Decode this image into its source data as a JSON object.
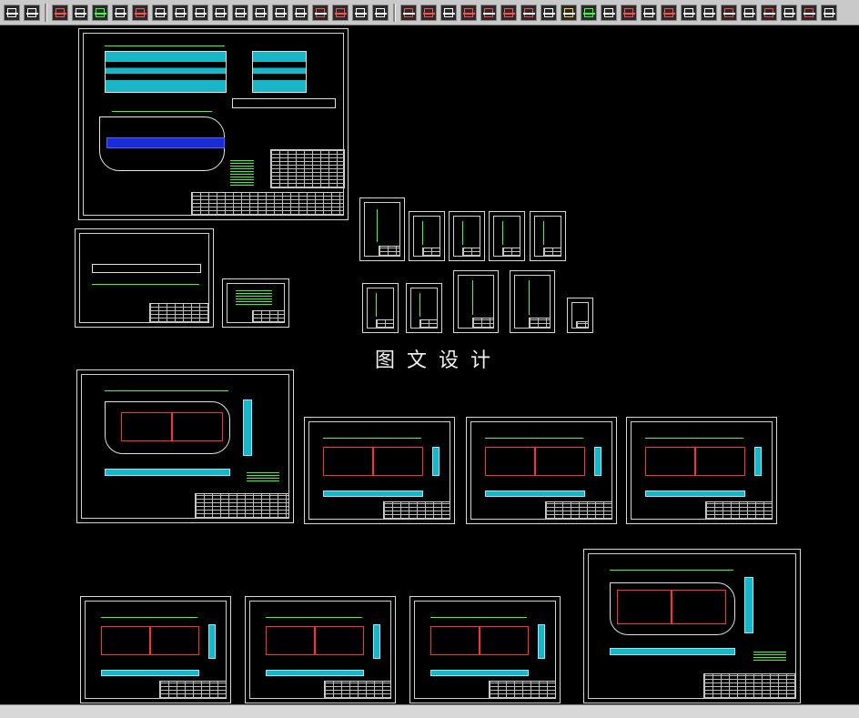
{
  "toolbar": {
    "buttons": [
      {
        "icon": "table-tool-icon",
        "color": "#ffffff"
      },
      {
        "icon": "text-style-icon",
        "color": "#ffffff"
      },
      {
        "icon": "hatch-pattern-icon",
        "color": "#ff4f4f"
      },
      {
        "icon": "dimension-style-icon",
        "color": "#ffffff"
      },
      {
        "icon": "layer-icon",
        "color": "#3cff3c"
      },
      {
        "icon": "linear-dimension-icon",
        "color": "#ffffff"
      },
      {
        "icon": "circle-mark-icon",
        "color": "#ff4f4f"
      },
      {
        "icon": "list-icon",
        "color": "#ffffff"
      },
      {
        "icon": "fork-icon",
        "color": "#ffffff"
      },
      {
        "icon": "frame-icon",
        "color": "#ffffff"
      },
      {
        "icon": "column-icon",
        "color": "#ffffff"
      },
      {
        "icon": "diagonal-tool-icon",
        "color": "#ffffff"
      },
      {
        "icon": "section-icon",
        "color": "#ffffff"
      },
      {
        "icon": "grid-icon",
        "color": "#ffffff"
      },
      {
        "icon": "split-icon",
        "color": "#ffffff"
      },
      {
        "icon": "gear-symbol-icon",
        "color": "#ff4f4f"
      },
      {
        "icon": "target-icon",
        "color": "#ff4f4f"
      },
      {
        "icon": "fork-down-icon",
        "color": "#ffffff"
      },
      {
        "icon": "bracket-icon",
        "color": "#ffffff"
      },
      {
        "icon": "cross-axis-icon",
        "color": "#ff4f4f"
      },
      {
        "icon": "rectangle-flag-icon",
        "color": "#ff4f4f"
      },
      {
        "icon": "diagonal-arrow-icon",
        "color": "#ffffff"
      },
      {
        "icon": "chevron-diagonal-icon",
        "color": "#ff4f4f"
      },
      {
        "icon": "wave-line-icon",
        "color": "#ff4f4f"
      },
      {
        "icon": "bar-graph-icon",
        "color": "#ff4f4f"
      },
      {
        "icon": "zigzag-icon",
        "color": "#ff4f4f"
      },
      {
        "icon": "arrow-right-icon",
        "color": "#ffffff"
      },
      {
        "icon": "stairs-icon",
        "color": "#ffd53c"
      },
      {
        "icon": "list-flag-icon",
        "color": "#3cff3c"
      },
      {
        "icon": "triangle-icon",
        "color": "#ffffff"
      },
      {
        "icon": "chevron-up-icon",
        "color": "#ff4f4f"
      },
      {
        "icon": "diagonal-lines-icon",
        "color": "#ffffff"
      },
      {
        "icon": "slash-icon",
        "color": "#ff4f4f"
      },
      {
        "icon": "angle-icon",
        "color": "#ffffff"
      },
      {
        "icon": "crop-icon",
        "color": "#ffffff"
      },
      {
        "icon": "rotate-icon",
        "color": "#ff4f4f"
      },
      {
        "icon": "mirror-icon",
        "color": "#ffffff"
      },
      {
        "icon": "vertical-split-icon",
        "color": "#ff4f4f"
      },
      {
        "icon": "diagonal-cut-icon",
        "color": "#ffffff"
      },
      {
        "icon": "corner-icon",
        "color": "#ff4f4f"
      },
      {
        "icon": "extend-icon",
        "color": "#ffffff"
      }
    ]
  },
  "canvas": {
    "center_text": "图文设计",
    "sheets": [
      {
        "name": "assembly-drawing-sheet",
        "type": "assembly"
      },
      {
        "name": "strip-layout-sheet",
        "type": "strip"
      },
      {
        "name": "small-notes-sheet",
        "type": "notes"
      },
      {
        "name": "part-sheet-a1",
        "type": "small"
      },
      {
        "name": "part-sheet-a2",
        "type": "small"
      },
      {
        "name": "part-sheet-a3",
        "type": "small"
      },
      {
        "name": "part-sheet-a4",
        "type": "small"
      },
      {
        "name": "part-sheet-a5",
        "type": "small"
      },
      {
        "name": "part-sheet-b1",
        "type": "small"
      },
      {
        "name": "part-sheet-b2",
        "type": "small"
      },
      {
        "name": "part-sheet-b3",
        "type": "small"
      },
      {
        "name": "part-sheet-b4",
        "type": "small"
      },
      {
        "name": "part-sheet-b5",
        "type": "small"
      },
      {
        "name": "plate-sheet-large-1",
        "type": "plate"
      },
      {
        "name": "plate-sheet-r2-1",
        "type": "plate"
      },
      {
        "name": "plate-sheet-r2-2",
        "type": "plate"
      },
      {
        "name": "plate-sheet-r2-3",
        "type": "plate"
      },
      {
        "name": "plate-sheet-r3-1",
        "type": "plate"
      },
      {
        "name": "plate-sheet-r3-2",
        "type": "plate"
      },
      {
        "name": "plate-sheet-r3-3",
        "type": "plate"
      },
      {
        "name": "plate-sheet-large-2",
        "type": "plate"
      }
    ]
  },
  "colors": {
    "background": "#000000",
    "frame": "#d8d8d8",
    "dimension": "#3cff3c",
    "outline_red": "#ff3030",
    "cyan": "#19b6c8",
    "blue": "#1a2bd8"
  }
}
